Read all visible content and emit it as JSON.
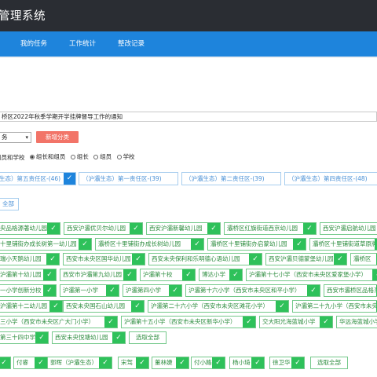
{
  "header": {
    "title": "管理系统"
  },
  "nav": {
    "items": [
      "我的任务",
      "工作统计",
      "整改记录"
    ]
  },
  "notice": {
    "text": "桥区2022年秋季学期开学挂牌督导工作的通知"
  },
  "filter": {
    "select_value": "务",
    "add_button": "新增分类"
  },
  "radios": {
    "items": [
      "组员和学校",
      "组长和组员",
      "组长",
      "组员",
      "学校"
    ],
    "checked_index": 1
  },
  "regions": [
    {
      "label": "生态）第五责任区-(46)",
      "selected": true
    },
    {
      "label": "（沪灞生态）第一责任区-(39)",
      "selected": false
    },
    {
      "label": "（沪灞生态）第二责任区-(39)",
      "selected": false
    },
    {
      "label": "（沪灞生态）第四责任区-(48)",
      "selected": false
    }
  ],
  "all_button": "全部",
  "schools": {
    "row1": [
      "央品格源著幼儿园",
      "西安沪灞优贝尔幼儿园",
      "西安沪灞新馨幼儿园",
      "灞桥区红旗街道西京幼儿园",
      "西安沪灞启航幼儿园"
    ],
    "row2": [
      "十里铺街办成长树第一幼儿园",
      "灞桥区十里铺街办成长树幼儿园",
      "灞桥区十里铺街办启蒙幼儿园",
      "灞桥区十里铺街道草原牌"
    ],
    "row3": [
      "瑞小天鹅幼儿园",
      "西安市未央区国华幼儿园",
      "西安未央保利和乐明德心语幼儿园",
      "西安沪灞贝德蒙堡幼儿园",
      "灞桥区"
    ],
    "row4": [
      "沪灞第十幼儿园",
      "西安市沪灞第九幼儿园",
      "沪灞第十校",
      "博达小学",
      "沪灞第十七小学（西安市未央区爱家堡小学）"
    ],
    "row5": [
      "一小学创新分校",
      "沪灞第一小学",
      "沪灞第四小学",
      "沪灞第十六小学（西安市未央区和平小学）",
      "西安市灞桥区品格东方"
    ],
    "row6": [
      "沪灞第十二幼儿园",
      "西安未央国石山幼儿园",
      "沪灞第二十六小学（西安市未央区滩花小学）",
      "沪灞第二十九小学（西安市未央"
    ],
    "row7": [
      "三小学（西安市未央区广大门小学）",
      "沪灞第十五小学（西安市未央区新华小学）",
      "交大阳光海蓝城小学",
      "华远海蓝城小学"
    ],
    "row8": [
      "第三十四中学",
      "西安未央悦塘幼儿园"
    ],
    "select_all": "选取全部"
  },
  "people": {
    "items": [
      "付睿",
      "郭晖（沪灞生态）",
      "宋驾",
      "董林婕",
      "付小路",
      "杨小琦",
      "徐卫华"
    ],
    "select_all": "选取全部"
  }
}
